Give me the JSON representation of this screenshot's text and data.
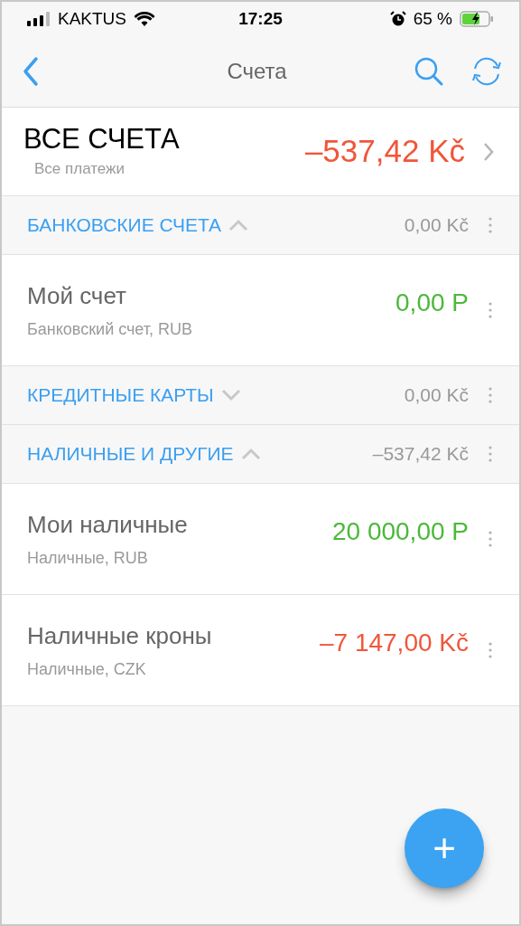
{
  "status_bar": {
    "carrier": "KAKTUS",
    "time": "17:25",
    "battery": "65 %"
  },
  "nav": {
    "title": "Счета"
  },
  "all_accounts": {
    "title": "ВСЕ СЧЕТА",
    "subtitle": "Все платежи",
    "amount": "–537,42 Kč"
  },
  "sections": [
    {
      "title": "БАНКОВСКИЕ СЧЕТА",
      "expanded": true,
      "total": "0,00 Kč",
      "accounts": [
        {
          "name": "Мой счет",
          "type": "Банковский счет, RUB",
          "amount": "0,00 Р",
          "color": "#4cb83a"
        }
      ]
    },
    {
      "title": "КРЕДИТНЫЕ КАРТЫ",
      "expanded": false,
      "total": "0,00 Kč"
    },
    {
      "title": "НАЛИЧНЫЕ И ДРУГИЕ",
      "expanded": true,
      "total": "–537,42 Kč",
      "accounts": [
        {
          "name": "Мои наличные",
          "type": "Наличные, RUB",
          "amount": "20 000,00 Р",
          "color": "#4cb83a"
        },
        {
          "name": "Наличные кроны",
          "type": "Наличные, CZK",
          "amount": "–7 147,00 Kč",
          "color": "#f0563a"
        }
      ]
    }
  ],
  "fab": {
    "label": "+"
  }
}
